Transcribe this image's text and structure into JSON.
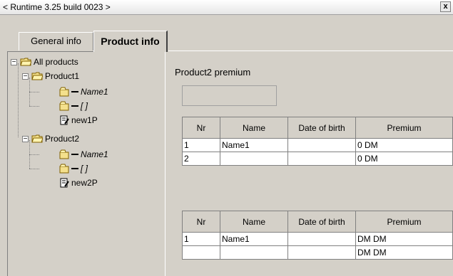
{
  "window": {
    "title": "< Runtime 3.25 build 0023 >",
    "close_label": "x"
  },
  "tabs": [
    {
      "label": "General info",
      "active": false
    },
    {
      "label": "Product info",
      "active": true
    }
  ],
  "tree": {
    "root_label": "All products",
    "expander_minus": "−",
    "products": [
      {
        "label": "Product1",
        "fields": [
          "Name1",
          "[ ]"
        ],
        "rule": "new1P"
      },
      {
        "label": "Product2",
        "fields": [
          "Name1",
          "[ ]"
        ],
        "rule": "new2P"
      }
    ]
  },
  "main": {
    "section_label": "Product2 premium",
    "table1": {
      "headers": [
        "Nr",
        "Name",
        "Date of birth",
        "Premium"
      ],
      "rows": [
        [
          "1",
          "Name1",
          "",
          "0 DM"
        ],
        [
          "2",
          "",
          "",
          "0 DM"
        ]
      ]
    },
    "table2": {
      "headers": [
        "Nr",
        "Name",
        "Date of birth",
        "Premium"
      ],
      "rows": [
        [
          "1",
          "Name1",
          "",
          "DM DM"
        ],
        [
          "",
          "",
          "",
          "DM DM"
        ]
      ]
    }
  },
  "colors": {
    "background": "#d4d0c8",
    "folder_yellow": "#f4e08c",
    "grid_border": "#808080"
  }
}
